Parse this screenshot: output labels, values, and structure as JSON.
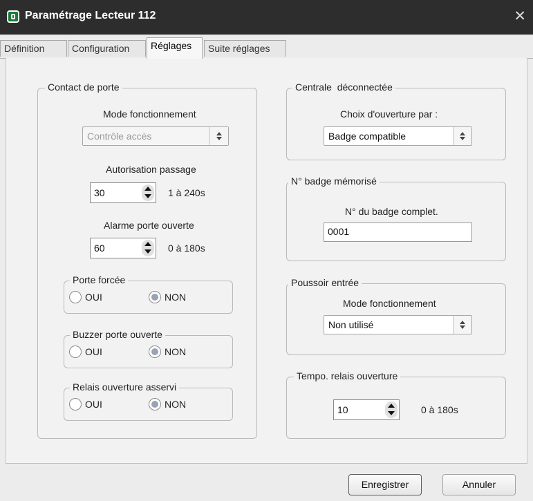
{
  "window": {
    "title": "Paramétrage Lecteur 112",
    "close_glyph": "✕"
  },
  "tabs": [
    {
      "label": "Définition"
    },
    {
      "label": "Configuration"
    },
    {
      "label": "Réglages"
    },
    {
      "label": "Suite réglages"
    }
  ],
  "contact": {
    "legend": "Contact de porte",
    "mode_label": "Mode fonctionnement",
    "mode_value": "Contrôle accès",
    "passage_label": "Autorisation passage",
    "passage_value": "30",
    "passage_range": "1 à 240s",
    "alarme_label": "Alarme porte ouverte",
    "alarme_value": "60",
    "alarme_range": "0 à 180s",
    "forcee": {
      "legend": "Porte forcée",
      "oui": "OUI",
      "non": "NON",
      "selected": "NON"
    },
    "buzzer": {
      "legend": "Buzzer porte ouverte",
      "oui": "OUI",
      "non": "NON",
      "selected": "NON"
    },
    "relais": {
      "legend": "Relais ouverture asservi",
      "oui": "OUI",
      "non": "NON",
      "selected": "NON"
    }
  },
  "centrale": {
    "legend": "Centrale  déconnectée",
    "choix_label": "Choix d'ouverture par :",
    "choix_value": "Badge compatible"
  },
  "badge": {
    "legend": "N° badge mémorisé",
    "label": "N° du badge complet.",
    "value": "0001"
  },
  "poussoir": {
    "legend": "Poussoir entrée",
    "mode_label": "Mode fonctionnement",
    "mode_value": "Non utilisé"
  },
  "tempo": {
    "legend": "Tempo. relais ouverture",
    "value": "10",
    "range": "0 à 180s"
  },
  "buttons": {
    "save": "Enregistrer",
    "cancel": "Annuler"
  }
}
